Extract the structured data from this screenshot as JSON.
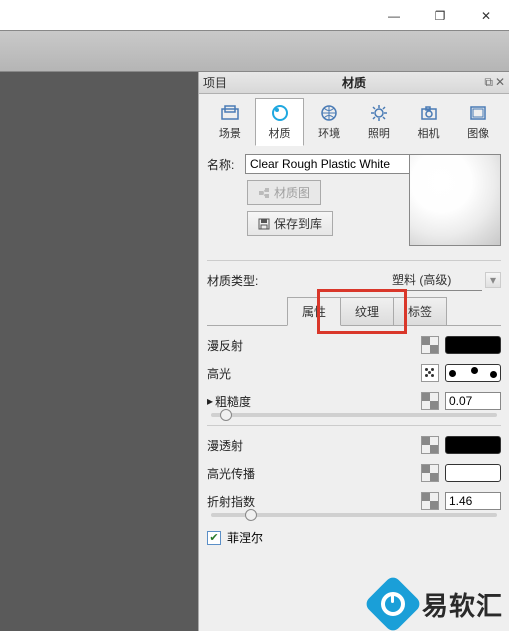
{
  "window": {
    "minimize": "—",
    "maximize": "❐",
    "close": "✕"
  },
  "panel": {
    "project": "项目",
    "title": "材质",
    "detach": "⧉",
    "close": "✕",
    "tabs": [
      {
        "label": "场景"
      },
      {
        "label": "材质"
      },
      {
        "label": "环境"
      },
      {
        "label": "照明"
      },
      {
        "label": "相机"
      },
      {
        "label": "图像"
      }
    ],
    "name_label": "名称:",
    "name_value": "Clear Rough Plastic White",
    "btn_matgraph": "材质图",
    "btn_save": "保存到库",
    "type_label": "材质类型:",
    "type_value": "塑料 (高级)",
    "subtabs": [
      {
        "label": "属性"
      },
      {
        "label": "纹理"
      },
      {
        "label": "标签"
      }
    ],
    "props": {
      "diffuse": "漫反射",
      "specular": "高光",
      "roughness": "粗糙度",
      "roughness_val": "0.07",
      "diffuse_trans": "漫透射",
      "spec_trans": "高光传播",
      "refraction": "折射指数",
      "refraction_val": "1.46",
      "fresnel": "菲涅尔"
    }
  },
  "watermark": {
    "text": "易软汇"
  }
}
